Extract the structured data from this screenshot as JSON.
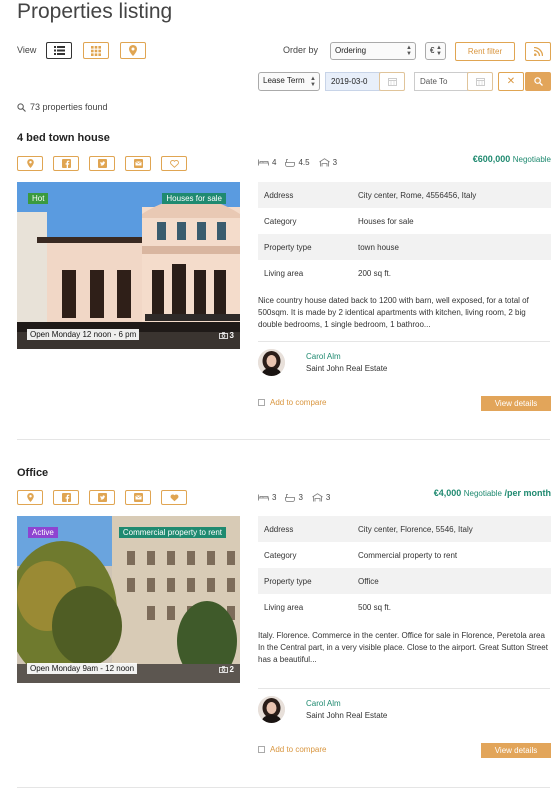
{
  "page": {
    "title": "Properties listing"
  },
  "toolbar": {
    "view_label": "View",
    "order_label": "Order by",
    "ordering_value": "Ordering",
    "currency_value": "€",
    "rent_filter_label": "Rent filter"
  },
  "filters": {
    "lease_value": "Lease Term",
    "date_from_value": "2019-03-0",
    "date_to_placeholder": "Date To"
  },
  "results": {
    "count_text": "73 properties found"
  },
  "colors": {
    "accent": "#e0a552",
    "green": "#1f8a70",
    "hot_badge": "#3a9a3f",
    "active_badge": "#8e44d1"
  },
  "properties": [
    {
      "title": "4 bed town house",
      "features": {
        "beds": "4",
        "baths": "4.5",
        "garages": "3"
      },
      "price": "€600,000",
      "price_note": "Negotiable",
      "price_suffix": "",
      "status_badge": "Hot",
      "type_badge": "Houses for sale",
      "open_house": "Open Monday 12 noon - 6 pm",
      "photo_count": "3",
      "details": [
        {
          "label": "Address",
          "value": "City center, Rome, 4556456, Italy"
        },
        {
          "label": "Category",
          "value": "Houses for sale"
        },
        {
          "label": "Property type",
          "value": "town house"
        },
        {
          "label": "Living area",
          "value": "200 sq ft."
        }
      ],
      "description": "Nice country house dated back to 1200 with barn, well exposed, for a total of 500sqm. It is made by 2 identical apartments with kitchen, living room, 2 big double bedrooms, 1 single bedroom, 1 bathroo...",
      "agent_name": "Carol Alm",
      "agency": "Saint John Real Estate",
      "compare_label": "Add to compare",
      "details_label": "View details"
    },
    {
      "title": "Office",
      "features": {
        "beds": "3",
        "baths": "3",
        "garages": "3"
      },
      "price": "€4,000",
      "price_note": "Negotiable",
      "price_suffix": "/per month",
      "status_badge": "Active",
      "type_badge": "Commercial property to rent",
      "open_house": "Open Monday 9am - 12 noon",
      "photo_count": "2",
      "details": [
        {
          "label": "Address",
          "value": "City center, Florence, 5546, Italy"
        },
        {
          "label": "Category",
          "value": "Commercial property to rent"
        },
        {
          "label": "Property type",
          "value": "Office"
        },
        {
          "label": "Living area",
          "value": "500 sq ft."
        }
      ],
      "description": "Italy. Florence. Commerce in the center.  Office for sale in Florence, Peretola area\nIn the Central part, in a very visible place. Close to the airport. Great Sutton Street has a beautiful...",
      "agent_name": "Carol Alm",
      "agency": "Saint John Real Estate",
      "compare_label": "Add to compare",
      "details_label": "View details"
    }
  ]
}
